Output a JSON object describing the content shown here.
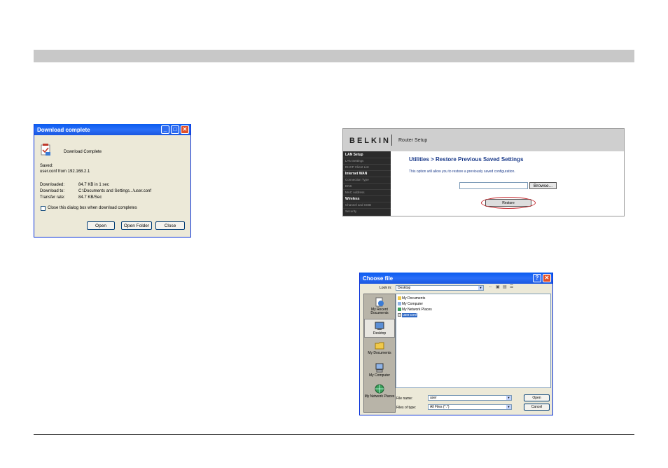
{
  "download_dialog": {
    "title": "Download complete",
    "message": "Download Complete",
    "saved_label": "Saved:",
    "saved_value": "user.conf from 192.168.2.1",
    "downloaded_label": "Downloaded:",
    "downloaded_value": "84.7 KB in 1 sec",
    "download_to_label": "Download to:",
    "download_to_value": "C:\\Documents and Settings...\\user.conf",
    "transfer_rate_label": "Transfer rate:",
    "transfer_rate_value": "84.7 KB/Sec",
    "close_checkbox_label": "Close this dialog box when download completes",
    "buttons": {
      "open": "Open",
      "open_folder": "Open Folder",
      "close": "Close"
    },
    "window_controls": {
      "minimize": "_",
      "maximize": "□",
      "close": "✕"
    }
  },
  "router": {
    "logo": "BELKIN",
    "header_title": "Router Setup",
    "nav": [
      {
        "label": "LAN Setup",
        "header": true
      },
      {
        "label": "LAN Settings",
        "header": false
      },
      {
        "label": "DHCP Client List",
        "header": false
      },
      {
        "label": "Internet WAN",
        "header": true
      },
      {
        "label": "Connection Type",
        "header": false
      },
      {
        "label": "DNS",
        "header": false
      },
      {
        "label": "MAC Address",
        "header": false
      },
      {
        "label": "Wireless",
        "header": true
      },
      {
        "label": "Channel and SSID",
        "header": false
      },
      {
        "label": "Security",
        "header": false
      }
    ],
    "breadcrumb": "Utilities > Restore Previous Saved Settings",
    "description": "This option will allow you to restore a previously saved configuration.",
    "file_input_value": "",
    "browse_label": "Browse...",
    "restore_label": "Restore",
    "highlight_color": "#c4262c"
  },
  "choose_file": {
    "title": "Choose file",
    "help_glyph": "?",
    "close_glyph": "✕",
    "look_in_label": "Look in:",
    "look_in_value": "Desktop",
    "places": [
      {
        "label": "My Recent Documents",
        "icon": "recent-documents-icon"
      },
      {
        "label": "Desktop",
        "icon": "desktop-icon",
        "selected": true
      },
      {
        "label": "My Documents",
        "icon": "my-documents-icon"
      },
      {
        "label": "My Computer",
        "icon": "my-computer-icon"
      },
      {
        "label": "My Network Places",
        "icon": "network-places-icon"
      }
    ],
    "files": [
      {
        "label": "My Documents",
        "icon": "folder-icon"
      },
      {
        "label": "My Computer",
        "icon": "computer-icon"
      },
      {
        "label": "My Network Places",
        "icon": "network-icon"
      },
      {
        "label": "user.conf",
        "icon": "file-icon",
        "selected": true
      }
    ],
    "file_name_label": "File name:",
    "file_name_value": "user",
    "files_of_type_label": "Files of type:",
    "files_of_type_value": "All Files (*.*)",
    "open_label": "Open",
    "cancel_label": "Cancel"
  }
}
